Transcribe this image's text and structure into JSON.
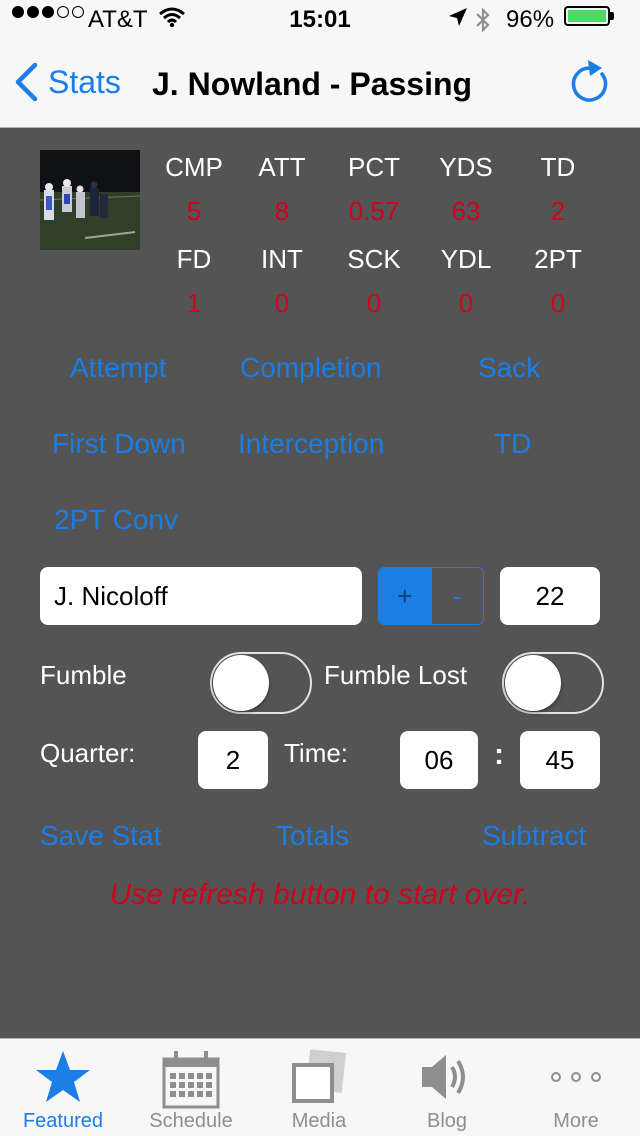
{
  "status_bar": {
    "carrier": "AT&T",
    "time": "15:01",
    "battery": "96%"
  },
  "nav": {
    "back_label": "Stats",
    "title": "J. Nowland - Passing"
  },
  "stats": {
    "row1": [
      {
        "label": "CMP",
        "value": "5"
      },
      {
        "label": "ATT",
        "value": "8"
      },
      {
        "label": "PCT",
        "value": "0.57"
      },
      {
        "label": "YDS",
        "value": "63"
      },
      {
        "label": "TD",
        "value": "2"
      }
    ],
    "row2": [
      {
        "label": "FD",
        "value": "1"
      },
      {
        "label": "INT",
        "value": "0"
      },
      {
        "label": "SCK",
        "value": "0"
      },
      {
        "label": "YDL",
        "value": "0"
      },
      {
        "label": "2PT",
        "value": "0"
      }
    ]
  },
  "actions": {
    "attempt": "Attempt",
    "completion": "Completion",
    "sack": "Sack",
    "first_down": "First Down",
    "interception": "Interception",
    "td": "TD",
    "two_pt": "2PT Conv"
  },
  "entry": {
    "player": "J. Nicoloff",
    "plus": "+",
    "minus": "-",
    "yards": "22",
    "fumble_label": "Fumble",
    "fumble_lost_label": "Fumble Lost",
    "quarter_label": "Quarter:",
    "quarter": "2",
    "time_label": "Time:",
    "minutes": "06",
    "colon": ":",
    "seconds": "45"
  },
  "bottom_actions": {
    "save": "Save Stat",
    "totals": "Totals",
    "subtract": "Subtract"
  },
  "hint": "Use refresh button to start over.",
  "tabs": [
    {
      "label": "Featured",
      "icon": "star-icon"
    },
    {
      "label": "Schedule",
      "icon": "calendar-icon"
    },
    {
      "label": "Media",
      "icon": "media-icon"
    },
    {
      "label": "Blog",
      "icon": "speaker-icon"
    },
    {
      "label": "More",
      "icon": "more-icon"
    }
  ],
  "colors": {
    "accent": "#1a7ee6",
    "value_red": "#d0021b",
    "background": "#545454",
    "battery": "#4cd964"
  }
}
